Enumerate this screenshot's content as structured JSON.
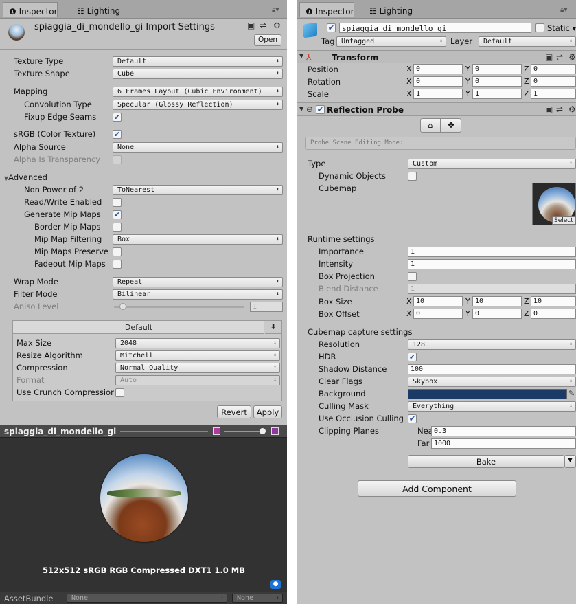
{
  "left": {
    "tabs": {
      "inspector": "Inspector",
      "lighting": "Lighting"
    },
    "header": {
      "title": "spiaggia_di_mondello_gi Import Settings",
      "open_button": "Open"
    },
    "texture_type": {
      "label": "Texture Type",
      "value": "Default"
    },
    "texture_shape": {
      "label": "Texture Shape",
      "value": "Cube"
    },
    "mapping": {
      "label": "Mapping",
      "value": "6 Frames Layout (Cubic Environment)"
    },
    "convolution_type": {
      "label": "Convolution Type",
      "value": "Specular (Glossy Reflection)"
    },
    "fixup_edge_seams": {
      "label": "Fixup Edge Seams",
      "checked": true
    },
    "srgb": {
      "label": "sRGB (Color Texture)",
      "checked": true
    },
    "alpha_source": {
      "label": "Alpha Source",
      "value": "None"
    },
    "alpha_is_transparency": {
      "label": "Alpha Is Transparency",
      "checked": false
    },
    "advanced": {
      "label": "Advanced"
    },
    "non_power_of_2": {
      "label": "Non Power of 2",
      "value": "ToNearest"
    },
    "read_write": {
      "label": "Read/Write Enabled",
      "checked": false
    },
    "generate_mip": {
      "label": "Generate Mip Maps",
      "checked": true
    },
    "border_mip": {
      "label": "Border Mip Maps",
      "checked": false
    },
    "mip_filtering": {
      "label": "Mip Map Filtering",
      "value": "Box"
    },
    "mip_preserve": {
      "label": "Mip Maps Preserve",
      "checked": false
    },
    "fadeout_mip": {
      "label": "Fadeout Mip Maps",
      "checked": false
    },
    "wrap_mode": {
      "label": "Wrap Mode",
      "value": "Repeat"
    },
    "filter_mode": {
      "label": "Filter Mode",
      "value": "Bilinear"
    },
    "aniso_level": {
      "label": "Aniso Level",
      "value": "1",
      "slider_fraction": 0.0
    },
    "platform": {
      "tab": "Default",
      "download_icon": "⬇"
    },
    "max_size": {
      "label": "Max Size",
      "value": "2048"
    },
    "resize_algorithm": {
      "label": "Resize Algorithm",
      "value": "Mitchell"
    },
    "compression": {
      "label": "Compression",
      "value": "Normal Quality"
    },
    "format": {
      "label": "Format",
      "value": "Auto"
    },
    "crunch": {
      "label": "Use Crunch Compressior",
      "checked": false
    },
    "revert_button": "Revert",
    "apply_button": "Apply",
    "preview": {
      "title": "spiaggia_di_mondello_gi",
      "info": "512x512 sRGB  RGB Compressed DXT1  1.0 MB"
    },
    "assetbundle": {
      "label": "AssetBundle",
      "value1": "None",
      "value2": "None"
    }
  },
  "right": {
    "tabs": {
      "inspector": "Inspector",
      "lighting": "Lighting"
    },
    "object": {
      "name": "spiaggia_di_mondello_gi",
      "active": true,
      "static_label": "Static",
      "static_checked": false
    },
    "tag": {
      "label": "Tag",
      "value": "Untagged"
    },
    "layer": {
      "label": "Layer",
      "value": "Default"
    },
    "transform": {
      "title": "Transform",
      "rows": [
        {
          "label": "Position",
          "x": "0",
          "y": "0",
          "z": "0"
        },
        {
          "label": "Rotation",
          "x": "0",
          "y": "0",
          "z": "0"
        },
        {
          "label": "Scale",
          "x": "1",
          "y": "1",
          "z": "1"
        }
      ]
    },
    "reflection_probe": {
      "title": "Reflection Probe",
      "enabled": true,
      "scene_editing_mode": "Probe Scene Editing Mode:",
      "type": {
        "label": "Type",
        "value": "Custom"
      },
      "dynamic_objects": {
        "label": "Dynamic Objects",
        "checked": false
      },
      "cubemap": {
        "label": "Cubemap",
        "select": "Select"
      },
      "runtime_settings": "Runtime settings",
      "importance": {
        "label": "Importance",
        "value": "1"
      },
      "intensity": {
        "label": "Intensity",
        "value": "1"
      },
      "box_projection": {
        "label": "Box Projection",
        "checked": false
      },
      "blend_distance": {
        "label": "Blend Distance",
        "value": "1"
      },
      "box_size": {
        "label": "Box Size",
        "x": "10",
        "y": "10",
        "z": "10"
      },
      "box_offset": {
        "label": "Box Offset",
        "x": "0",
        "y": "0",
        "z": "0"
      },
      "capture_settings": "Cubemap capture settings",
      "resolution": {
        "label": "Resolution",
        "value": "128"
      },
      "hdr": {
        "label": "HDR",
        "checked": true
      },
      "shadow_distance": {
        "label": "Shadow Distance",
        "value": "100"
      },
      "clear_flags": {
        "label": "Clear Flags",
        "value": "Skybox"
      },
      "background": {
        "label": "Background",
        "color": "#1c3a66"
      },
      "culling_mask": {
        "label": "Culling Mask",
        "value": "Everything"
      },
      "occlusion_culling": {
        "label": "Use Occlusion Culling",
        "checked": true
      },
      "clipping_planes": {
        "label": "Clipping Planes",
        "near_label": "Near",
        "near": "0.3",
        "far_label": "Far",
        "far": "1000"
      },
      "bake_button": "Bake"
    },
    "add_component": "Add Component"
  },
  "axis_labels": {
    "x": "X",
    "y": "Y",
    "z": "Z"
  },
  "check_glyph": "✔"
}
